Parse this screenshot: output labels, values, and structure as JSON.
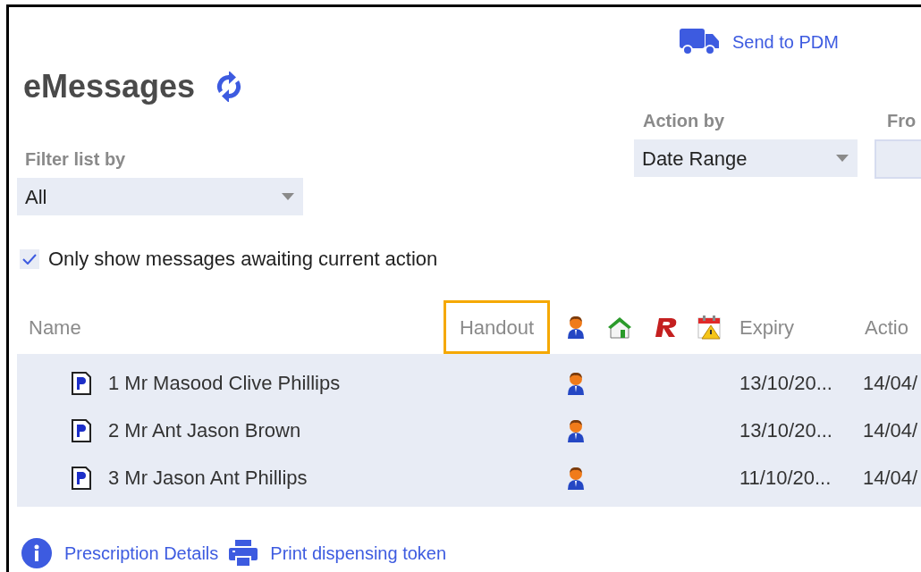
{
  "toolbar": {
    "send_link": "Send to PDM"
  },
  "title": "eMessages",
  "filters": {
    "filter_label": "Filter list by",
    "filter_value": "All",
    "action_label": "Action by",
    "action_value": "Date Range",
    "from_label": "Fro"
  },
  "only_awaiting": {
    "label": "Only show messages awaiting current action",
    "checked": true
  },
  "table": {
    "columns": [
      {
        "kind": "text",
        "label": "Name",
        "highlighted": false
      },
      {
        "kind": "text",
        "label": "Handout",
        "highlighted": true
      },
      {
        "kind": "person"
      },
      {
        "kind": "house"
      },
      {
        "kind": "rx"
      },
      {
        "kind": "calendar"
      },
      {
        "kind": "text",
        "label": "Expiry",
        "highlighted": false
      },
      {
        "kind": "text",
        "label": "Actio",
        "highlighted": false
      }
    ],
    "rows": [
      {
        "name": "1 Mr Masood Clive Phillips",
        "patient": true,
        "expiry": "13/10/20...",
        "action": "14/04/"
      },
      {
        "name": "2 Mr Ant Jason Brown",
        "patient": true,
        "expiry": "13/10/20...",
        "action": "14/04/"
      },
      {
        "name": "3 Mr Jason Ant Phillips",
        "patient": true,
        "expiry": "11/10/20...",
        "action": "14/04/"
      }
    ]
  },
  "footer": {
    "links": [
      "Prescription Details",
      "Print dispensing token"
    ]
  }
}
